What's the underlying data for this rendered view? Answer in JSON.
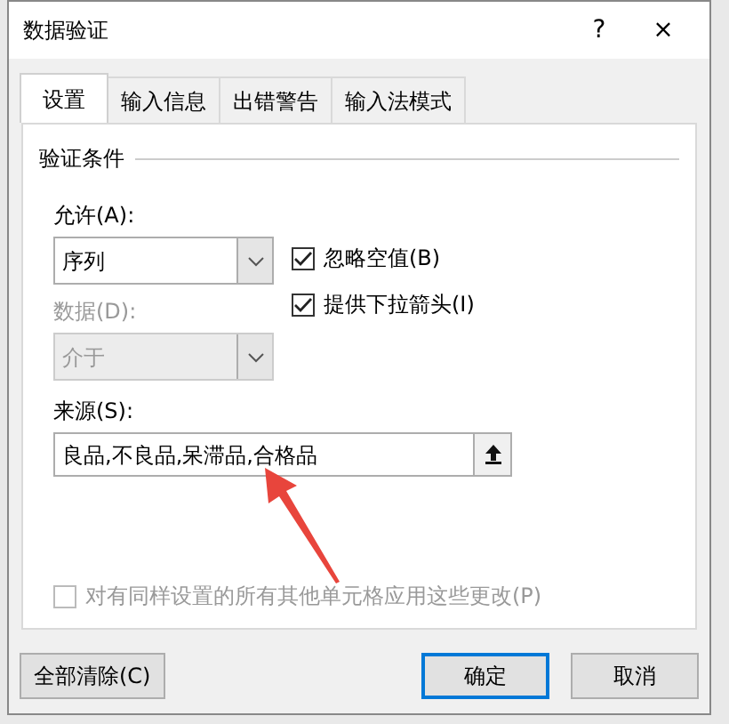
{
  "window": {
    "title": "数据验证",
    "help": "?",
    "close": "×"
  },
  "tabs": [
    {
      "label": "设置",
      "selected": true
    },
    {
      "label": "输入信息",
      "selected": false
    },
    {
      "label": "出错警告",
      "selected": false
    },
    {
      "label": "输入法模式",
      "selected": false
    }
  ],
  "group_title": "验证条件",
  "allow": {
    "label": "允许(A):",
    "value": "序列",
    "disabled": false
  },
  "options": [
    {
      "label": "忽略空值(B)",
      "checked": true,
      "disabled": false
    },
    {
      "label": "提供下拉箭头(I)",
      "checked": true,
      "disabled": false
    }
  ],
  "data": {
    "label": "数据(D):",
    "value": "介于",
    "disabled": true
  },
  "source": {
    "label": "来源(S):",
    "value": "良品,不良品,呆滞品,合格品"
  },
  "apply_all": {
    "label": "对有同样设置的所有其他单元格应用这些更改(P)",
    "checked": false,
    "disabled": true
  },
  "buttons": [
    {
      "label": "全部清除(C)",
      "kind": "left",
      "default": false
    },
    {
      "label": "确定",
      "kind": "right",
      "default": true
    },
    {
      "label": "取消",
      "kind": "right",
      "default": false
    }
  ]
}
